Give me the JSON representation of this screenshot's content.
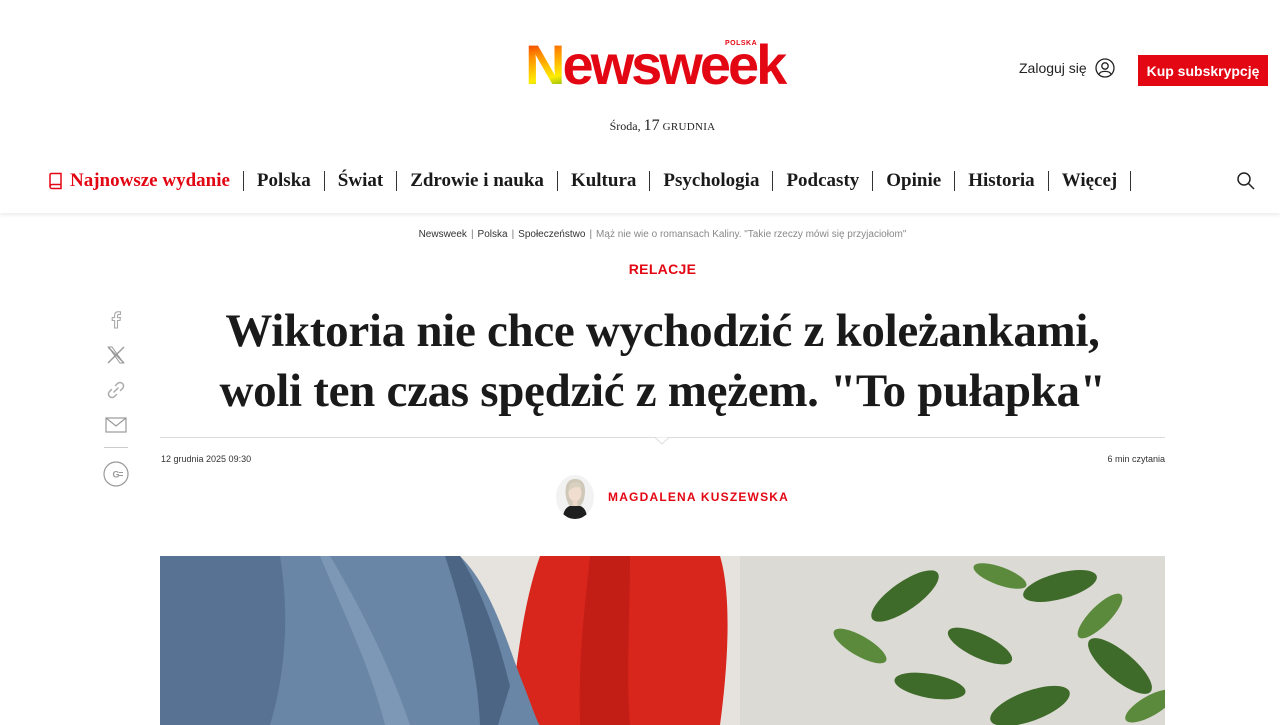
{
  "header": {
    "logo_text": "Newsweek",
    "logo_edition": "POLSKA",
    "login_label": "Zaloguj się",
    "subscribe_label": "Kup subskrypcję",
    "date_day": "Środa,",
    "date_number": "17",
    "date_month": "GRUDNIA"
  },
  "nav": {
    "items": [
      "Najnowsze wydanie",
      "Polska",
      "Świat",
      "Zdrowie i nauka",
      "Kultura",
      "Psychologia",
      "Podcasty",
      "Opinie",
      "Historia",
      "Więcej"
    ]
  },
  "breadcrumb": {
    "items": [
      "Newsweek",
      "Polska",
      "Społeczeństwo"
    ],
    "current": "Mąż nie wie o romansach Kaliny. \"Takie rzeczy mówi się przyjaciołom\""
  },
  "article": {
    "category": "RELACJE",
    "title_line1": "Wiktoria nie chce wychodzić z koleżankami,",
    "title_line2": "woli ten czas spędzić z mężem. \"To pułapka\"",
    "published": "12 grudnia 2025 09:30",
    "read_time": "6 min czytania",
    "author": "MAGDALENA KUSZEWSKA"
  },
  "social": {
    "icons": [
      "facebook-icon",
      "x-icon",
      "link-icon",
      "mail-icon",
      "google-news-icon"
    ]
  },
  "colors": {
    "accent": "#e30613",
    "text": "#1a1a1a"
  }
}
